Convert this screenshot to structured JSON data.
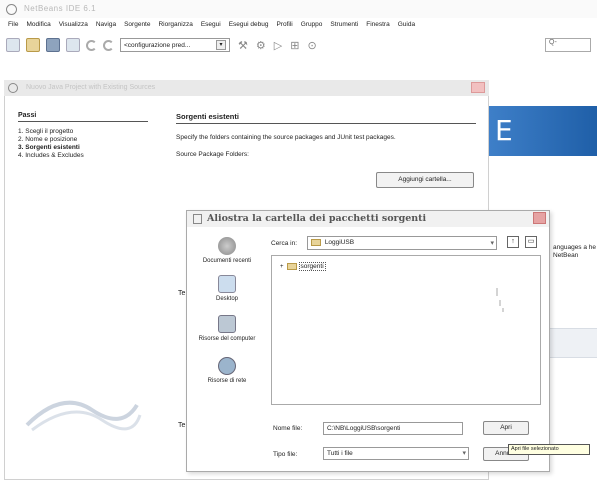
{
  "app": {
    "title": "NetBeans IDE 6.1"
  },
  "menu": [
    "File",
    "Modifica",
    "Visualizza",
    "Naviga",
    "Sorgente",
    "Riorganizza",
    "Esegui",
    "Esegui debug",
    "Profili",
    "Gruppo",
    "Strumenti",
    "Finestra",
    "Guida"
  ],
  "toolbar": {
    "config_value": "<configurazione pred...",
    "search_placeholder": "Q-"
  },
  "wizard": {
    "title": "Nuovo Java Project with Existing Sources",
    "steps_heading": "Passi",
    "steps": [
      {
        "num": "1.",
        "label": "Scegli il progetto"
      },
      {
        "num": "2.",
        "label": "Nome e posizione"
      },
      {
        "num": "3.",
        "label": "Sorgenti esistenti"
      },
      {
        "num": "4.",
        "label": "Includes & Excludes"
      }
    ],
    "active_step": 3,
    "panel_heading": "Sorgenti esistenti",
    "description": "Specify the folders containing the source packages and JUnit test packages.",
    "source_label": "Source Package Folders:",
    "add_folder_button": "Aggiungi cartella...",
    "partial_label_1": "Te",
    "partial_label_2": "Te"
  },
  "background_window": {
    "banner_letter": "E",
    "text": "anguages a he NetBean"
  },
  "chooser": {
    "title": "Aliostra la cartella dei pacchetti sorgenti",
    "places": [
      {
        "label": "Documenti recenti",
        "icon": "recent-documents-icon"
      },
      {
        "label": "Desktop",
        "icon": "desktop-icon"
      },
      {
        "label": "Risorse del computer",
        "icon": "computer-icon"
      },
      {
        "label": "Risorse di rete",
        "icon": "network-icon"
      }
    ],
    "look_in_label": "Cerca in:",
    "look_in_value": "LoggiUSB",
    "items": [
      {
        "name": "sorgenti",
        "marker": "+"
      }
    ],
    "filename_label": "Nome file:",
    "filename_value": "C:\\NB\\LoggiUSB\\sorgenti",
    "filetype_label": "Tipo file:",
    "filetype_value": "Tutti i file",
    "open_button": "Apri",
    "cancel_button": "Annulla",
    "tooltip": "Apri file selezionato"
  }
}
